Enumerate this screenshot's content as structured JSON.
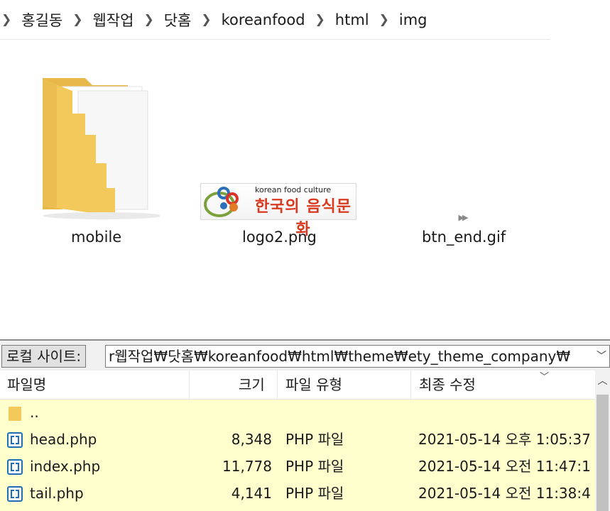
{
  "breadcrumb": {
    "items": [
      {
        "label": "홍길동"
      },
      {
        "label": "웹작업"
      },
      {
        "label": "닷홈"
      },
      {
        "label": "koreanfood"
      },
      {
        "label": "html"
      },
      {
        "label": "img"
      }
    ]
  },
  "files": {
    "items": [
      {
        "name": "mobile",
        "kind": "folder-icon"
      },
      {
        "name": "logo2.png",
        "kind": "image-thumbnail",
        "thumb_top_text": "korean food culture",
        "thumb_main_text": "한국의 음식문화"
      },
      {
        "name": "btn_end.gif",
        "kind": "gif-icon"
      }
    ]
  },
  "ftp": {
    "site_label": "로컬 사이트:",
    "path": "r웹작업₩닷홈₩koreanfood₩html₩theme₩ety_theme_company₩",
    "columns": {
      "name": "파일명",
      "size": "크기",
      "type": "파일 유형",
      "modified": "최종 수정"
    },
    "rows": [
      {
        "name": "..",
        "size": "",
        "type": "",
        "modified": "",
        "icon": "folder-icon"
      },
      {
        "name": "head.php",
        "size": "8,348",
        "type": "PHP 파일",
        "modified": "2021-05-14 오후 1:05:37",
        "icon": "php-file-icon"
      },
      {
        "name": "index.php",
        "size": "11,778",
        "type": "PHP 파일",
        "modified": "2021-05-14 오전 11:47:1",
        "icon": "php-file-icon"
      },
      {
        "name": "tail.php",
        "size": "4,141",
        "type": "PHP 파일",
        "modified": "2021-05-14 오전 11:38:4",
        "icon": "php-file-icon"
      }
    ]
  },
  "colors": {
    "list_background": "#ffffce",
    "folder_yellow": "#f3c95c",
    "php_icon_blue": "#1e6fb5"
  }
}
